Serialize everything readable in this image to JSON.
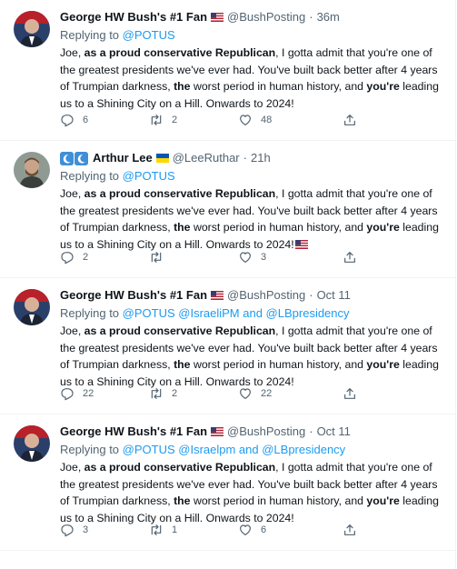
{
  "tweets": [
    {
      "name": "George HW Bush's #1 Fan",
      "handle": "@BushPosting",
      "sep": "·",
      "time": "36m",
      "reply_prefix": "Replying to",
      "reply_to": "@POTUS",
      "body": {
        "p1": "Joe,",
        "b1": " as a proud conservative Republican",
        "p2": ", I gotta admit that you're one of the greatest presidents we've ever had. You've built back better after 4 years of Trumpian darkness, ",
        "b2": "the",
        "p3": " worst period in human history, and ",
        "b3": "you're",
        "p4": " leading us to a Shining City on a Hill. Onwards to 2024!"
      },
      "replies": "6",
      "retweets": "2",
      "likes": "48"
    },
    {
      "name": "Arthur Lee",
      "handle": "@LeeRuthar",
      "sep": "·",
      "time": "21h",
      "reply_prefix": "Replying to",
      "reply_to": "@POTUS",
      "body": {
        "p1": "Joe,",
        "b1": " as a proud conservative Republican",
        "p2": ", I gotta admit that you're one of the greatest presidents we've ever had. You've built back better after 4 years of Trumpian darkness, ",
        "b2": "the",
        "p3": " worst period in human history, and ",
        "b3": "you're",
        "p4": " leading us to a Shining City on a Hill. Onwards to 2024!"
      },
      "replies": "2",
      "retweets": "",
      "likes": "3"
    },
    {
      "name": "George HW Bush's #1 Fan",
      "handle": "@BushPosting",
      "sep": "·",
      "time": "Oct 11",
      "reply_prefix": "Replying to",
      "reply_to": "@POTUS @IsraeliPM and @LBpresidency",
      "body": {
        "p1": "Joe,",
        "b1": " as a proud conservative Republican",
        "p2": ", I gotta admit that you're one of the greatest presidents we've ever had. You've built back better after 4 years of Trumpian darkness, ",
        "b2": "the",
        "p3": " worst period in human history, and ",
        "b3": "you're",
        "p4": " leading us to a Shining City on a Hill. Onwards to 2024!"
      },
      "replies": "22",
      "retweets": "2",
      "likes": "22"
    },
    {
      "name": "George HW Bush's #1 Fan",
      "handle": "@BushPosting",
      "sep": "·",
      "time": "Oct 11",
      "reply_prefix": "Replying to",
      "reply_to": "@POTUS @Israelpm and @LBpresidency",
      "body": {
        "p1": "Joe,",
        "b1": " as a proud conservative Republican",
        "p2": ", I gotta admit that you're one of the greatest presidents we've ever had. You've built back better after 4 years of Trumpian darkness, ",
        "b2": "the",
        "p3": " worst period in human history, and ",
        "b3": "you're",
        "p4": " leading us to a Shining City on a Hill. Onwards to 2024!"
      },
      "replies": "3",
      "retweets": "1",
      "likes": "6"
    }
  ],
  "icons": {
    "us_flag": "us-flag-icon",
    "ukraine_flag": "ukraine-flag-icon",
    "moon": "crescent-moon-icon",
    "reply": "reply-icon",
    "retweet": "retweet-icon",
    "like": "heart-icon",
    "share": "share-icon"
  },
  "colors": {
    "accent": "#1d9bf0",
    "muted": "#536471",
    "text": "#0f1419",
    "divider": "#eff3f4"
  }
}
